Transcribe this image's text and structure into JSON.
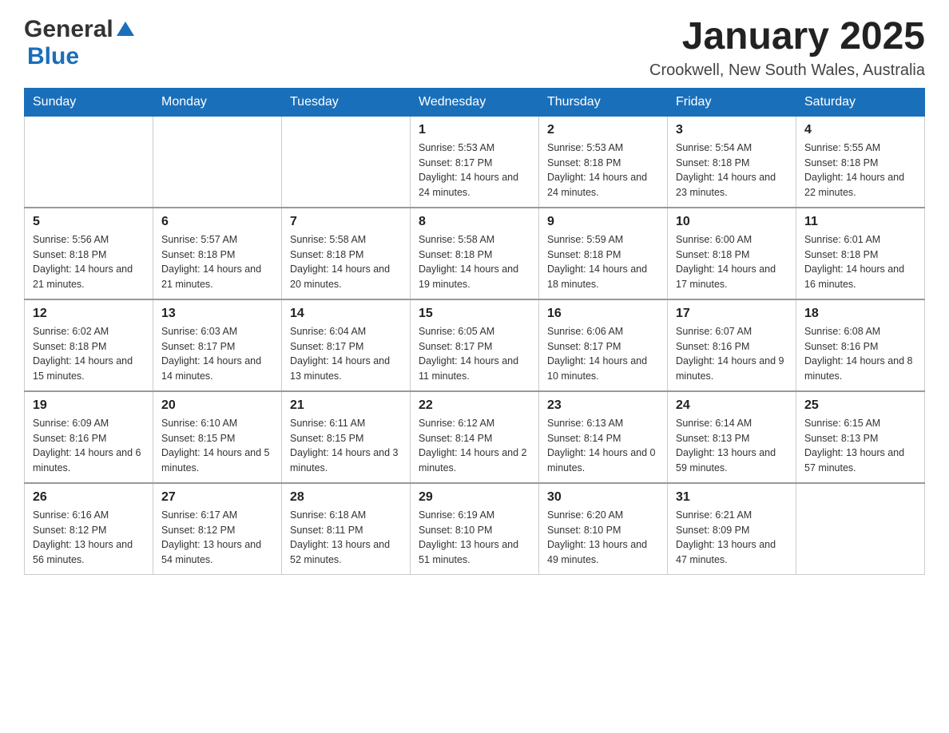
{
  "header": {
    "logo_general": "General",
    "logo_blue": "Blue",
    "title": "January 2025",
    "subtitle": "Crookwell, New South Wales, Australia"
  },
  "columns": [
    "Sunday",
    "Monday",
    "Tuesday",
    "Wednesday",
    "Thursday",
    "Friday",
    "Saturday"
  ],
  "weeks": [
    [
      {
        "day": "",
        "info": ""
      },
      {
        "day": "",
        "info": ""
      },
      {
        "day": "",
        "info": ""
      },
      {
        "day": "1",
        "info": "Sunrise: 5:53 AM\nSunset: 8:17 PM\nDaylight: 14 hours\nand 24 minutes."
      },
      {
        "day": "2",
        "info": "Sunrise: 5:53 AM\nSunset: 8:18 PM\nDaylight: 14 hours\nand 24 minutes."
      },
      {
        "day": "3",
        "info": "Sunrise: 5:54 AM\nSunset: 8:18 PM\nDaylight: 14 hours\nand 23 minutes."
      },
      {
        "day": "4",
        "info": "Sunrise: 5:55 AM\nSunset: 8:18 PM\nDaylight: 14 hours\nand 22 minutes."
      }
    ],
    [
      {
        "day": "5",
        "info": "Sunrise: 5:56 AM\nSunset: 8:18 PM\nDaylight: 14 hours\nand 21 minutes."
      },
      {
        "day": "6",
        "info": "Sunrise: 5:57 AM\nSunset: 8:18 PM\nDaylight: 14 hours\nand 21 minutes."
      },
      {
        "day": "7",
        "info": "Sunrise: 5:58 AM\nSunset: 8:18 PM\nDaylight: 14 hours\nand 20 minutes."
      },
      {
        "day": "8",
        "info": "Sunrise: 5:58 AM\nSunset: 8:18 PM\nDaylight: 14 hours\nand 19 minutes."
      },
      {
        "day": "9",
        "info": "Sunrise: 5:59 AM\nSunset: 8:18 PM\nDaylight: 14 hours\nand 18 minutes."
      },
      {
        "day": "10",
        "info": "Sunrise: 6:00 AM\nSunset: 8:18 PM\nDaylight: 14 hours\nand 17 minutes."
      },
      {
        "day": "11",
        "info": "Sunrise: 6:01 AM\nSunset: 8:18 PM\nDaylight: 14 hours\nand 16 minutes."
      }
    ],
    [
      {
        "day": "12",
        "info": "Sunrise: 6:02 AM\nSunset: 8:18 PM\nDaylight: 14 hours\nand 15 minutes."
      },
      {
        "day": "13",
        "info": "Sunrise: 6:03 AM\nSunset: 8:17 PM\nDaylight: 14 hours\nand 14 minutes."
      },
      {
        "day": "14",
        "info": "Sunrise: 6:04 AM\nSunset: 8:17 PM\nDaylight: 14 hours\nand 13 minutes."
      },
      {
        "day": "15",
        "info": "Sunrise: 6:05 AM\nSunset: 8:17 PM\nDaylight: 14 hours\nand 11 minutes."
      },
      {
        "day": "16",
        "info": "Sunrise: 6:06 AM\nSunset: 8:17 PM\nDaylight: 14 hours\nand 10 minutes."
      },
      {
        "day": "17",
        "info": "Sunrise: 6:07 AM\nSunset: 8:16 PM\nDaylight: 14 hours\nand 9 minutes."
      },
      {
        "day": "18",
        "info": "Sunrise: 6:08 AM\nSunset: 8:16 PM\nDaylight: 14 hours\nand 8 minutes."
      }
    ],
    [
      {
        "day": "19",
        "info": "Sunrise: 6:09 AM\nSunset: 8:16 PM\nDaylight: 14 hours\nand 6 minutes."
      },
      {
        "day": "20",
        "info": "Sunrise: 6:10 AM\nSunset: 8:15 PM\nDaylight: 14 hours\nand 5 minutes."
      },
      {
        "day": "21",
        "info": "Sunrise: 6:11 AM\nSunset: 8:15 PM\nDaylight: 14 hours\nand 3 minutes."
      },
      {
        "day": "22",
        "info": "Sunrise: 6:12 AM\nSunset: 8:14 PM\nDaylight: 14 hours\nand 2 minutes."
      },
      {
        "day": "23",
        "info": "Sunrise: 6:13 AM\nSunset: 8:14 PM\nDaylight: 14 hours\nand 0 minutes."
      },
      {
        "day": "24",
        "info": "Sunrise: 6:14 AM\nSunset: 8:13 PM\nDaylight: 13 hours\nand 59 minutes."
      },
      {
        "day": "25",
        "info": "Sunrise: 6:15 AM\nSunset: 8:13 PM\nDaylight: 13 hours\nand 57 minutes."
      }
    ],
    [
      {
        "day": "26",
        "info": "Sunrise: 6:16 AM\nSunset: 8:12 PM\nDaylight: 13 hours\nand 56 minutes."
      },
      {
        "day": "27",
        "info": "Sunrise: 6:17 AM\nSunset: 8:12 PM\nDaylight: 13 hours\nand 54 minutes."
      },
      {
        "day": "28",
        "info": "Sunrise: 6:18 AM\nSunset: 8:11 PM\nDaylight: 13 hours\nand 52 minutes."
      },
      {
        "day": "29",
        "info": "Sunrise: 6:19 AM\nSunset: 8:10 PM\nDaylight: 13 hours\nand 51 minutes."
      },
      {
        "day": "30",
        "info": "Sunrise: 6:20 AM\nSunset: 8:10 PM\nDaylight: 13 hours\nand 49 minutes."
      },
      {
        "day": "31",
        "info": "Sunrise: 6:21 AM\nSunset: 8:09 PM\nDaylight: 13 hours\nand 47 minutes."
      },
      {
        "day": "",
        "info": ""
      }
    ]
  ]
}
